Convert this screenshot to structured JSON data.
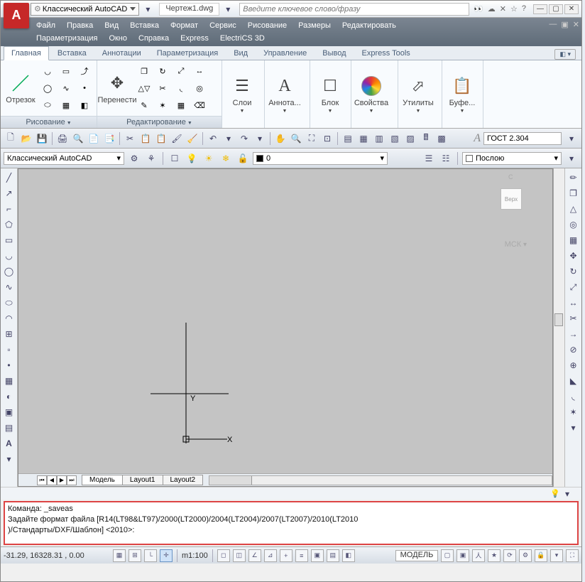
{
  "titlebar": {
    "logo": "A",
    "qat_workspace": "Классический AutoCAD",
    "doc_name": "Чертеж1.dwg",
    "search_placeholder": "Введите ключевое слово/фразу"
  },
  "menu": {
    "row1": [
      "Файл",
      "Правка",
      "Вид",
      "Вставка",
      "Формат",
      "Сервис",
      "Рисование",
      "Размеры",
      "Редактировать"
    ],
    "row2": [
      "Параметризация",
      "Окно",
      "Справка",
      "Express",
      "ElectriCS 3D"
    ]
  },
  "ribbon_tabs": [
    "Главная",
    "Вставка",
    "Аннотации",
    "Параметризация",
    "Вид",
    "Управление",
    "Вывод",
    "Express Tools"
  ],
  "ribbon": {
    "draw": {
      "title": "Рисование",
      "big": "Отрезок"
    },
    "mod": {
      "title": "Редактирование",
      "big": "Перенести"
    },
    "p3": "Слои",
    "p4": "Аннота...",
    "p5": "Блок",
    "p6": "Свойства",
    "p7": "Утилиты",
    "p8": "Буфе..."
  },
  "style_row": {
    "font_label": "A",
    "font_val": "ГОСТ 2.304"
  },
  "row2": {
    "workspace": "Классический AutoCAD",
    "layer_name": "0",
    "color_label": "Послою"
  },
  "canvas": {
    "ucs_x": "X",
    "ucs_y": "Y",
    "cube": "Верх",
    "msk": "МСК",
    "n": "С"
  },
  "layout_tabs": [
    "Модель",
    "Layout1",
    "Layout2"
  ],
  "cmd": {
    "l1": "Команда: _saveas",
    "l2": "Задайте формат файла [R14(LT98&LT97)/2000(LT2000)/2004(LT2004)/2007(LT2007)/2010(LT2010",
    "l3": ")/Стандарты/DXF/Шаблон] <2010>:"
  },
  "status": {
    "coords": "-31.29,  16328.31 , 0.00",
    "scale": "m1:100",
    "model": "МОДЕЛЬ"
  }
}
